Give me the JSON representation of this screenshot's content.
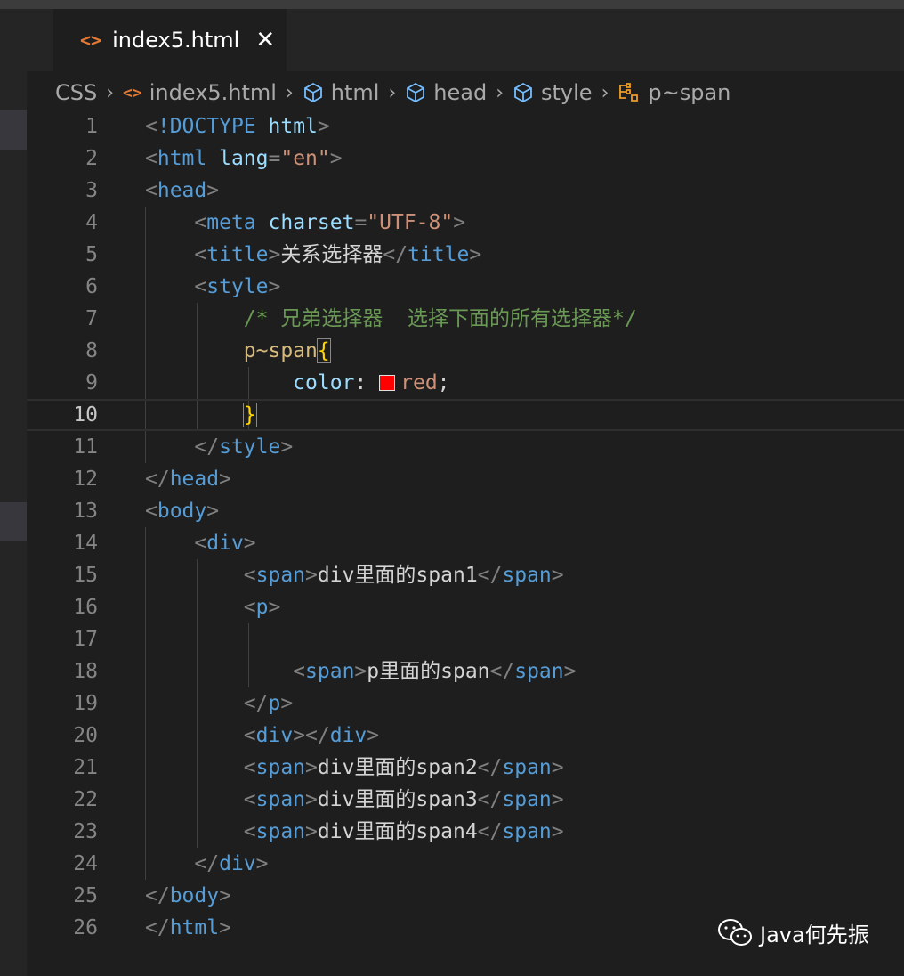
{
  "tab": {
    "icon": "code-file-icon",
    "label": "index5.html",
    "close": "✕"
  },
  "breadcrumb": [
    "CSS",
    "index5.html",
    "html",
    "head",
    "style",
    "p~span"
  ],
  "colors": {
    "accent_file_icon": "#e37933",
    "swatch": "#ff0000"
  },
  "lines": [
    {
      "n": "1",
      "tokens": [
        [
          "p",
          "<"
        ],
        [
          "tag",
          "!DOCTYPE"
        ],
        [
          "text",
          " "
        ],
        [
          "attr",
          "html"
        ],
        [
          "p",
          ">"
        ]
      ]
    },
    {
      "n": "2",
      "tokens": [
        [
          "p",
          "<"
        ],
        [
          "tag",
          "html"
        ],
        [
          "text",
          " "
        ],
        [
          "attr",
          "lang"
        ],
        [
          "p",
          "="
        ],
        [
          "str",
          "\"en\""
        ],
        [
          "p",
          ">"
        ]
      ]
    },
    {
      "n": "3",
      "tokens": [
        [
          "p",
          "<"
        ],
        [
          "tag",
          "head"
        ],
        [
          "p",
          ">"
        ]
      ]
    },
    {
      "n": "4",
      "tokens": [
        [
          "text",
          "    "
        ],
        [
          "p",
          "<"
        ],
        [
          "tag",
          "meta"
        ],
        [
          "text",
          " "
        ],
        [
          "attr",
          "charset"
        ],
        [
          "p",
          "="
        ],
        [
          "str",
          "\"UTF-8\""
        ],
        [
          "p",
          ">"
        ]
      ]
    },
    {
      "n": "5",
      "tokens": [
        [
          "text",
          "    "
        ],
        [
          "p",
          "<"
        ],
        [
          "tag",
          "title"
        ],
        [
          "p",
          ">"
        ],
        [
          "text",
          "关系选择器"
        ],
        [
          "p",
          "</"
        ],
        [
          "tag",
          "title"
        ],
        [
          "p",
          ">"
        ]
      ]
    },
    {
      "n": "6",
      "tokens": [
        [
          "text",
          "    "
        ],
        [
          "p",
          "<"
        ],
        [
          "tag",
          "style"
        ],
        [
          "p",
          ">"
        ]
      ]
    },
    {
      "n": "7",
      "tokens": [
        [
          "text",
          "        "
        ],
        [
          "com",
          "/* 兄弟选择器  选择下面的所有选择器*/"
        ]
      ]
    },
    {
      "n": "8",
      "tokens": [
        [
          "text",
          "        "
        ],
        [
          "sel",
          "p~span"
        ],
        [
          "brace",
          "{"
        ]
      ]
    },
    {
      "n": "9",
      "tokens": [
        [
          "text",
          "            "
        ],
        [
          "prop",
          "color"
        ],
        [
          "text",
          ": "
        ],
        [
          "swatch",
          ""
        ],
        [
          "val",
          "red"
        ],
        [
          "text",
          ";"
        ]
      ]
    },
    {
      "n": "10",
      "tokens": [
        [
          "text",
          "        "
        ],
        [
          "brace",
          "}"
        ]
      ]
    },
    {
      "n": "11",
      "tokens": [
        [
          "text",
          "    "
        ],
        [
          "p",
          "</"
        ],
        [
          "tag",
          "style"
        ],
        [
          "p",
          ">"
        ]
      ]
    },
    {
      "n": "12",
      "tokens": [
        [
          "p",
          "</"
        ],
        [
          "tag",
          "head"
        ],
        [
          "p",
          ">"
        ]
      ]
    },
    {
      "n": "13",
      "tokens": [
        [
          "p",
          "<"
        ],
        [
          "tag",
          "body"
        ],
        [
          "p",
          ">"
        ]
      ]
    },
    {
      "n": "14",
      "tokens": [
        [
          "text",
          "    "
        ],
        [
          "p",
          "<"
        ],
        [
          "tag",
          "div"
        ],
        [
          "p",
          ">"
        ]
      ]
    },
    {
      "n": "15",
      "tokens": [
        [
          "text",
          "        "
        ],
        [
          "p",
          "<"
        ],
        [
          "tag",
          "span"
        ],
        [
          "p",
          ">"
        ],
        [
          "text",
          "div里面的span1"
        ],
        [
          "p",
          "</"
        ],
        [
          "tag",
          "span"
        ],
        [
          "p",
          ">"
        ]
      ]
    },
    {
      "n": "16",
      "tokens": [
        [
          "text",
          "        "
        ],
        [
          "p",
          "<"
        ],
        [
          "tag",
          "p"
        ],
        [
          "p",
          ">"
        ]
      ]
    },
    {
      "n": "17",
      "tokens": []
    },
    {
      "n": "18",
      "tokens": [
        [
          "text",
          "            "
        ],
        [
          "p",
          "<"
        ],
        [
          "tag",
          "span"
        ],
        [
          "p",
          ">"
        ],
        [
          "text",
          "p里面的span"
        ],
        [
          "p",
          "</"
        ],
        [
          "tag",
          "span"
        ],
        [
          "p",
          ">"
        ]
      ]
    },
    {
      "n": "19",
      "tokens": [
        [
          "text",
          "        "
        ],
        [
          "p",
          "</"
        ],
        [
          "tag",
          "p"
        ],
        [
          "p",
          ">"
        ]
      ]
    },
    {
      "n": "20",
      "tokens": [
        [
          "text",
          "        "
        ],
        [
          "p",
          "<"
        ],
        [
          "tag",
          "div"
        ],
        [
          "p",
          "></"
        ],
        [
          "tag",
          "div"
        ],
        [
          "p",
          ">"
        ]
      ]
    },
    {
      "n": "21",
      "tokens": [
        [
          "text",
          "        "
        ],
        [
          "p",
          "<"
        ],
        [
          "tag",
          "span"
        ],
        [
          "p",
          ">"
        ],
        [
          "text",
          "div里面的span2"
        ],
        [
          "p",
          "</"
        ],
        [
          "tag",
          "span"
        ],
        [
          "p",
          ">"
        ]
      ]
    },
    {
      "n": "22",
      "tokens": [
        [
          "text",
          "        "
        ],
        [
          "p",
          "<"
        ],
        [
          "tag",
          "span"
        ],
        [
          "p",
          ">"
        ],
        [
          "text",
          "div里面的span3"
        ],
        [
          "p",
          "</"
        ],
        [
          "tag",
          "span"
        ],
        [
          "p",
          ">"
        ]
      ]
    },
    {
      "n": "23",
      "tokens": [
        [
          "text",
          "        "
        ],
        [
          "p",
          "<"
        ],
        [
          "tag",
          "span"
        ],
        [
          "p",
          ">"
        ],
        [
          "text",
          "div里面的span4"
        ],
        [
          "p",
          "</"
        ],
        [
          "tag",
          "span"
        ],
        [
          "p",
          ">"
        ]
      ]
    },
    {
      "n": "24",
      "tokens": [
        [
          "text",
          "    "
        ],
        [
          "p",
          "</"
        ],
        [
          "tag",
          "div"
        ],
        [
          "p",
          ">"
        ]
      ]
    },
    {
      "n": "25",
      "tokens": [
        [
          "p",
          "</"
        ],
        [
          "tag",
          "body"
        ],
        [
          "p",
          ">"
        ]
      ]
    },
    {
      "n": "26",
      "tokens": [
        [
          "p",
          "</"
        ],
        [
          "tag",
          "html"
        ],
        [
          "p",
          ">"
        ]
      ]
    }
  ],
  "current_line": "10",
  "watermark": {
    "icon": "wechat-icon",
    "text": "Java何先振"
  }
}
